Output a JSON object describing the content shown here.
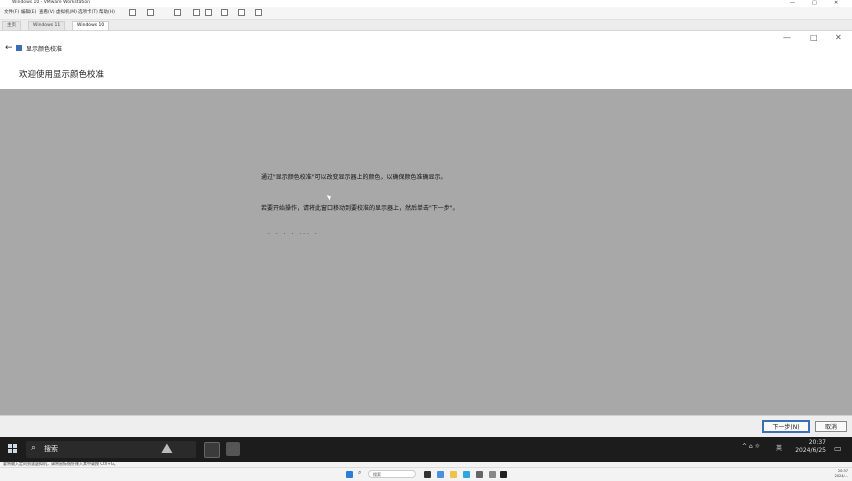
{
  "host": {
    "title": "Windows 10 - VMware Workstation",
    "window_controls": [
      "—",
      "□",
      "✕"
    ],
    "menu": [
      "文件(F)",
      "编辑(E)",
      "查看(V)",
      "虚拟机(M)",
      "选项卡(T)",
      "帮助(H)"
    ],
    "tabs": [
      {
        "label": "主页",
        "active": false
      },
      {
        "label": "Windows 11",
        "active": false
      },
      {
        "label": "Windows 10",
        "active": true
      }
    ],
    "status_text": "要将输入定向到该虚拟机，请将鼠标指针移入其中或按 Ctrl+G。",
    "taskbar": {
      "search_placeholder": "搜索",
      "time": "20:37",
      "date": "2024/..."
    }
  },
  "wizard": {
    "app_title": "显示颜色校准",
    "heading": "欢迎使用显示颜色校准",
    "paragraph1": "通过\"显示颜色校准\"可以改变显示器上的颜色，以确保颜色准确显示。",
    "paragraph2": "若要开始操作，请将此窗口移动到要校准的显示器上，然后单击\"下一步\"。",
    "dots": "· · · ·  ··· ·",
    "next_label": "下一步(N)",
    "cancel_label": "取消"
  },
  "guest_taskbar": {
    "search_label": "搜索",
    "tray_icons": "^ ⌂ ☼",
    "ime": "英",
    "time": "20:37",
    "date": "2024/6/25"
  },
  "colors": {
    "vm_background": "#a8a8a8",
    "accent": "#3a6fb5",
    "guest_taskbar": "#1c1c1c"
  }
}
